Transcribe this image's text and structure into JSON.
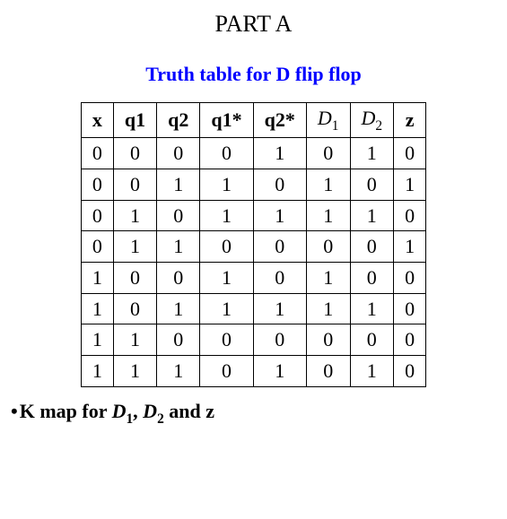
{
  "part_title": "PART A",
  "subtitle": "Truth table for D flip flop",
  "chart_data": {
    "type": "table",
    "headers": [
      "x",
      "q1",
      "q2",
      "q1*",
      "q2*",
      "D1",
      "D2",
      "z"
    ],
    "rows": [
      [
        "0",
        "0",
        "0",
        "0",
        "1",
        "0",
        "1",
        "0"
      ],
      [
        "0",
        "0",
        "1",
        "1",
        "0",
        "1",
        "0",
        "1"
      ],
      [
        "0",
        "1",
        "0",
        "1",
        "1",
        "1",
        "1",
        "0"
      ],
      [
        "0",
        "1",
        "1",
        "0",
        "0",
        "0",
        "0",
        "1"
      ],
      [
        "1",
        "0",
        "0",
        "1",
        "0",
        "1",
        "0",
        "0"
      ],
      [
        "1",
        "0",
        "1",
        "1",
        "1",
        "1",
        "1",
        "0"
      ],
      [
        "1",
        "1",
        "0",
        "0",
        "0",
        "0",
        "0",
        "0"
      ],
      [
        "1",
        "1",
        "1",
        "0",
        "1",
        "0",
        "1",
        "0"
      ]
    ]
  },
  "headers": {
    "h0": "x",
    "h1": "q1",
    "h2": "q2",
    "h3": "q1*",
    "h4": "q2*",
    "h5_base": "D",
    "h5_sub": "1",
    "h6_base": "D",
    "h6_sub": "2",
    "h7": "z"
  },
  "kmap": {
    "prefix": "K map for ",
    "d_base": "D",
    "d1_sub": "1",
    "sep": ", ",
    "d2_sub": "2",
    "tail": " and z"
  }
}
